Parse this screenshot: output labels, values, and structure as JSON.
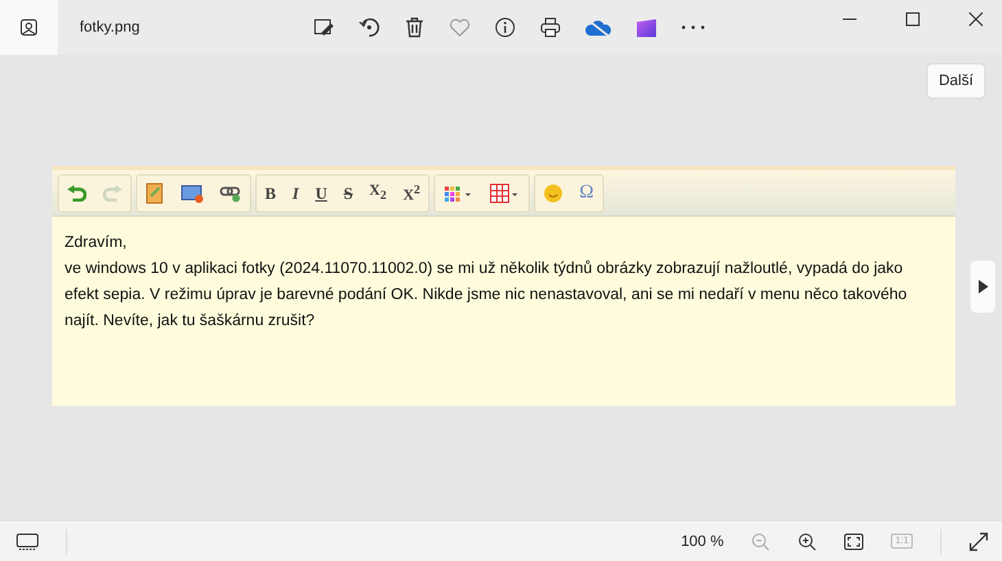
{
  "window": {
    "title": "fotky.png"
  },
  "next_button": {
    "label": "Další"
  },
  "editor": {
    "undo": {
      "disabled": false
    },
    "redo": {
      "disabled": true
    },
    "format_buttons": [
      {
        "kind": "bold",
        "label": "B"
      },
      {
        "kind": "italic",
        "label": "I"
      },
      {
        "kind": "underline",
        "label": "U"
      },
      {
        "kind": "strike",
        "label": "S"
      },
      {
        "kind": "sub",
        "label": "X$_{2}$"
      },
      {
        "kind": "sup",
        "label": "X$^{2}$"
      }
    ],
    "special_char_button": {
      "label": "Ω"
    },
    "paragraphs": [
      "Zdravím,",
      "ve windows 10 v aplikaci fotky (2024.11070.11002.0) se mi už několik týdnů obrázky zobrazují nažloutlé, vypadá do jako efekt sepia. V režimu úprav je barevné podání OK. Nikde jsme nic nenastavoval, ani se mi nedaří v menu něco takového najít. Nevíte, jak tu šaškárnu zrušit?"
    ]
  },
  "status_bar": {
    "zoom": "100 %",
    "zoom_out": {
      "disabled": true
    },
    "actual_size": {
      "label": "1:1",
      "disabled": true
    }
  }
}
